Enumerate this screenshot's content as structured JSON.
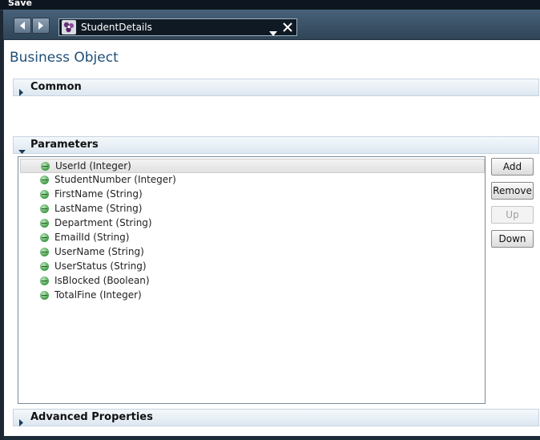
{
  "toolbar": {
    "save_label": "Save"
  },
  "document": {
    "title": "StudentDetails"
  },
  "page": {
    "heading": "Business Object"
  },
  "sections": {
    "common": "Common",
    "parameters": "Parameters",
    "advanced": "Advanced Properties"
  },
  "parameters": [
    "UserId (Integer)",
    "StudentNumber (Integer)",
    "FirstName (String)",
    "LastName (String)",
    "Department (String)",
    "EmailId (String)",
    "UserName (String)",
    "UserStatus (String)",
    "IsBlocked (Boolean)",
    "TotalFine (Integer)"
  ],
  "buttons": {
    "add": "Add",
    "remove": "Remove",
    "up": "Up",
    "down": "Down"
  }
}
